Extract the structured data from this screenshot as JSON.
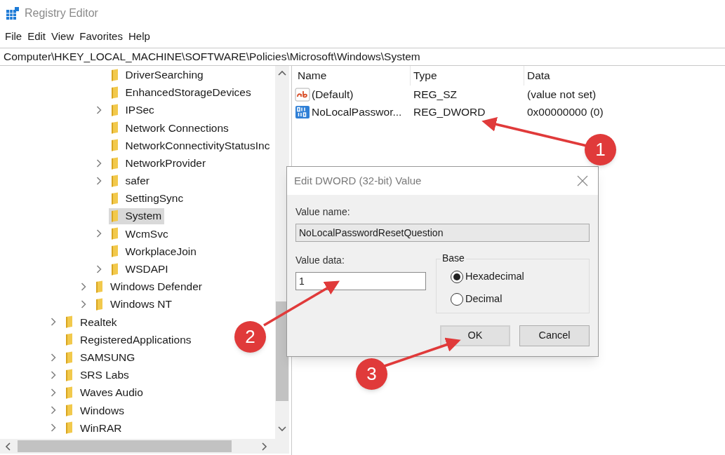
{
  "window": {
    "title": "Registry Editor"
  },
  "menu": [
    "File",
    "Edit",
    "View",
    "Favorites",
    "Help"
  ],
  "address": "Computer\\HKEY_LOCAL_MACHINE\\SOFTWARE\\Policies\\Microsoft\\Windows\\System",
  "tree": [
    {
      "children": [
        {
          "children": [
            {
              "children": [
                {
                  "label": "DriverSearching",
                  "has_children": false,
                  "selected": false
                },
                {
                  "label": "EnhancedStorageDevices",
                  "has_children": false,
                  "selected": false
                },
                {
                  "label": "IPSec",
                  "has_children": true,
                  "selected": false
                },
                {
                  "label": "Network Connections",
                  "has_children": false,
                  "selected": false
                },
                {
                  "label": "NetworkConnectivityStatusInc",
                  "has_children": false,
                  "selected": false
                },
                {
                  "label": "NetworkProvider",
                  "has_children": true,
                  "selected": false
                },
                {
                  "label": "safer",
                  "has_children": true,
                  "selected": false
                },
                {
                  "label": "SettingSync",
                  "has_children": false,
                  "selected": false
                },
                {
                  "label": "System",
                  "has_children": false,
                  "selected": true
                },
                {
                  "label": "WcmSvc",
                  "has_children": true,
                  "selected": false
                },
                {
                  "label": "WorkplaceJoin",
                  "has_children": false,
                  "selected": false
                },
                {
                  "label": "WSDAPI",
                  "has_children": true,
                  "selected": false
                }
              ]
            },
            {
              "label": "Windows Defender",
              "has_children": true,
              "selected": false
            },
            {
              "label": "Windows NT",
              "has_children": true,
              "selected": false
            }
          ]
        }
      ]
    },
    {
      "label": "Realtek",
      "has_children": true,
      "selected": false
    },
    {
      "label": "RegisteredApplications",
      "has_children": false,
      "selected": false
    },
    {
      "label": "SAMSUNG",
      "has_children": true,
      "selected": false
    },
    {
      "label": "SRS Labs",
      "has_children": true,
      "selected": false
    },
    {
      "label": "Waves Audio",
      "has_children": true,
      "selected": false
    },
    {
      "label": "Windows",
      "has_children": true,
      "selected": false
    },
    {
      "label": "WinRAR",
      "has_children": true,
      "selected": false
    }
  ],
  "values": {
    "columns": [
      "Name",
      "Type",
      "Data"
    ],
    "rows": [
      {
        "kind": "string",
        "name": "(Default)",
        "type": "REG_SZ",
        "data": "(value not set)"
      },
      {
        "kind": "binary",
        "name": "NoLocalPasswor...",
        "type": "REG_DWORD",
        "data": "0x00000000 (0)"
      }
    ]
  },
  "dialog": {
    "title": "Edit DWORD (32-bit) Value",
    "value_name_label": "Value name:",
    "value_name": "NoLocalPasswordResetQuestion",
    "value_data_label": "Value data:",
    "value_data": "1",
    "base_label": "Base",
    "base_options": [
      {
        "label": "Hexadecimal",
        "selected": true
      },
      {
        "label": "Decimal",
        "selected": false
      }
    ],
    "buttons": [
      {
        "label": "OK",
        "default": true
      },
      {
        "label": "Cancel",
        "default": false
      }
    ]
  },
  "callouts": [
    "1",
    "2",
    "3"
  ]
}
